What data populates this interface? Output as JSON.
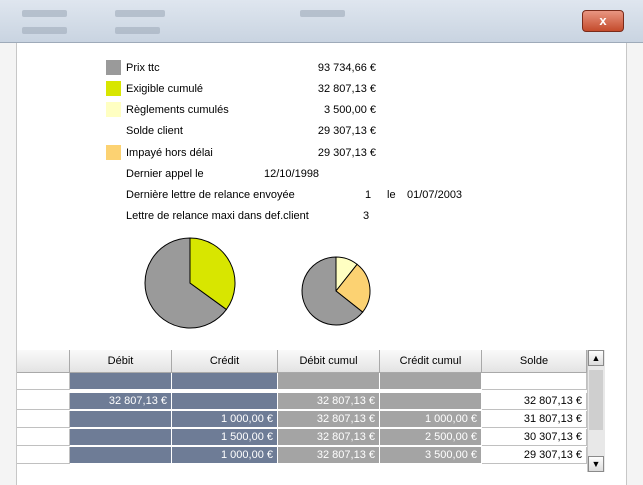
{
  "summary": {
    "prix_ttc": {
      "label": "Prix ttc",
      "value": "93 734,66 €",
      "color": "#9a9a9a"
    },
    "exigible": {
      "label": "Exigible cumulé",
      "value": "32 807,13 €",
      "color": "#d8e600"
    },
    "reglements": {
      "label": "Règlements cumulés",
      "value": "3 500,00 €",
      "color": "#ffffc2"
    },
    "solde": {
      "label": "Solde client",
      "value": "29 307,13 €"
    },
    "impaye": {
      "label": "Impayé hors délai",
      "value": "29 307,13 €",
      "color": "#fcd272"
    },
    "dernier_appel": {
      "label": "Dernier appel le",
      "value": "12/10/1998"
    },
    "derniere_lettre": {
      "label": "Dernière lettre de relance envoyée",
      "count": "1",
      "le": "le",
      "date": "01/07/2003"
    },
    "lettre_maxi": {
      "label": "Lettre de relance maxi dans def.client",
      "value": "3"
    }
  },
  "pies": {
    "pie1": {
      "total": 93734.66,
      "highlight": 32807.13,
      "base_color": "#9a9a9a",
      "highlight_color": "#d8e600"
    },
    "pie2": {
      "total": 32807.13,
      "highlights": [
        {
          "value": 3500.0,
          "color": "#ffffc2"
        },
        {
          "value": 8200.0,
          "color": "#fcd272"
        }
      ],
      "base_color": "#9a9a9a"
    }
  },
  "table": {
    "columns": [
      "Débit",
      "Crédit",
      "Débit cumul",
      "Crédit cumul",
      "Solde"
    ],
    "rows": [
      [
        "",
        "",
        "",
        "",
        ""
      ],
      [
        "32 807,13 €",
        "",
        "32 807,13 €",
        "",
        "32 807,13 €"
      ],
      [
        "",
        "1 000,00 €",
        "32 807,13 €",
        "1 000,00 €",
        "31 807,13 €"
      ],
      [
        "",
        "1 500,00 €",
        "32 807,13 €",
        "2 500,00 €",
        "30 307,13 €"
      ],
      [
        "",
        "1 000,00 €",
        "32 807,13 €",
        "3 500,00 €",
        "29 307,13 €"
      ]
    ]
  },
  "window": {
    "close_label": "x"
  }
}
